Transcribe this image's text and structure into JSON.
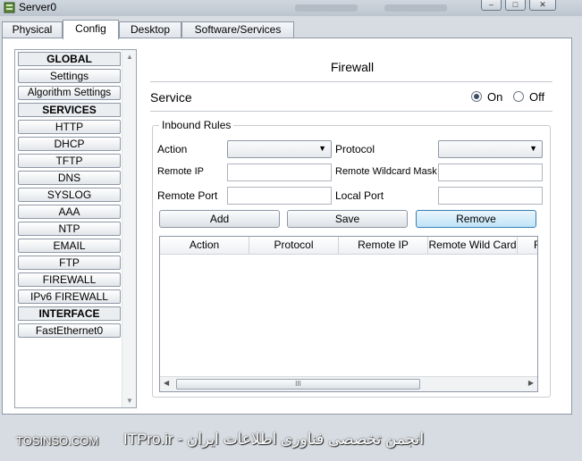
{
  "window": {
    "title": "Server0",
    "controls": [
      "minimize",
      "maximize",
      "close"
    ],
    "control_glyphs": [
      "–",
      "□",
      "✕"
    ]
  },
  "tabs": [
    "Physical",
    "Config",
    "Desktop",
    "Software/Services"
  ],
  "active_tab": "Config",
  "sidebar": {
    "items": [
      {
        "label": "GLOBAL",
        "type": "header"
      },
      {
        "label": "Settings",
        "type": "item"
      },
      {
        "label": "Algorithm Settings",
        "type": "item"
      },
      {
        "label": "SERVICES",
        "type": "header"
      },
      {
        "label": "HTTP",
        "type": "item"
      },
      {
        "label": "DHCP",
        "type": "item"
      },
      {
        "label": "TFTP",
        "type": "item"
      },
      {
        "label": "DNS",
        "type": "item"
      },
      {
        "label": "SYSLOG",
        "type": "item"
      },
      {
        "label": "AAA",
        "type": "item"
      },
      {
        "label": "NTP",
        "type": "item"
      },
      {
        "label": "EMAIL",
        "type": "item"
      },
      {
        "label": "FTP",
        "type": "item"
      },
      {
        "label": "FIREWALL",
        "type": "item"
      },
      {
        "label": "IPv6 FIREWALL",
        "type": "item"
      },
      {
        "label": "INTERFACE",
        "type": "header"
      },
      {
        "label": "FastEthernet0",
        "type": "item"
      }
    ]
  },
  "main": {
    "title": "Firewall",
    "service_label": "Service",
    "service_on": "On",
    "service_off": "Off",
    "service_state": "On",
    "inbound_rules": {
      "legend": "Inbound Rules",
      "action_label": "Action",
      "action_value": "",
      "protocol_label": "Protocol",
      "protocol_value": "",
      "remote_ip_label": "Remote IP",
      "remote_ip_value": "",
      "remote_wildcard_label": "Remote Wildcard Mask",
      "remote_wildcard_value": "",
      "remote_port_label": "Remote Port",
      "remote_port_value": "",
      "local_port_label": "Local Port",
      "local_port_value": "",
      "buttons": {
        "add": "Add",
        "save": "Save",
        "remove": "Remove"
      },
      "table_columns": [
        "Action",
        "Protocol",
        "Remote IP",
        "Remote Wild Card",
        "R"
      ],
      "table_rows": [],
      "hscroll_grip": "III"
    }
  },
  "watermark": {
    "left": "TOSINSO.COM",
    "right": "انجمن تخصصی فناوری اطلاعات ایران - ITPro.ir"
  },
  "colors": {
    "window_bg": "#d7dce2",
    "panel_bg": "#ffffff",
    "remove_button_highlight": "#bfe4f8"
  }
}
